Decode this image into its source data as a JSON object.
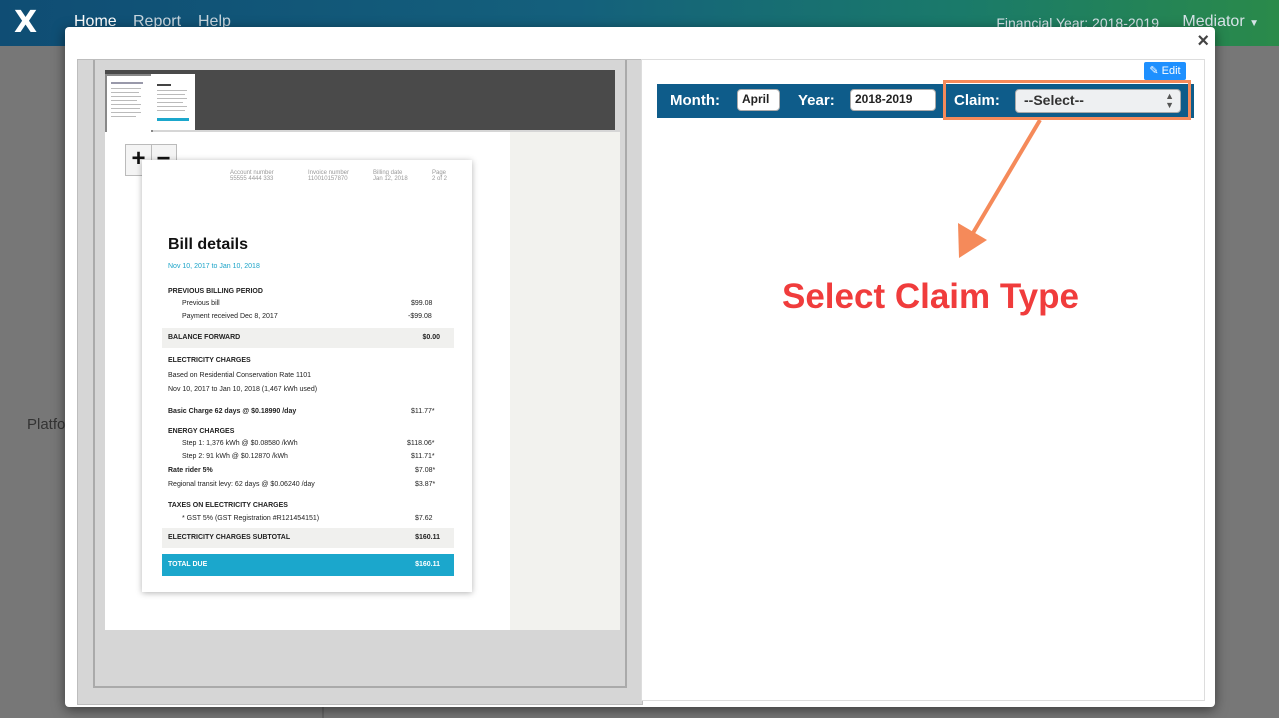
{
  "navbar": {
    "logo": "X",
    "items": [
      "Home",
      "Report",
      "Help"
    ],
    "financial_year": "Financial Year: 2018-2019",
    "user_menu": "Mediator"
  },
  "background": {
    "partial_text": "Platfo"
  },
  "modal": {
    "close_label": "×"
  },
  "viewer": {
    "zoom_in": "+",
    "zoom_out": "−",
    "document": {
      "header": [
        {
          "label": "Account number",
          "value": "55555 4444 333"
        },
        {
          "label": "Invoice number",
          "value": "110010157870"
        },
        {
          "label": "Billing date",
          "value": "Jan 12, 2018"
        },
        {
          "label": "Page",
          "value": "2 of 2"
        }
      ],
      "title": "Bill details",
      "period": "Nov 10, 2017 to Jan 10, 2018",
      "previous_heading": "PREVIOUS BILLING PERIOD",
      "previous_bill": "Previous bill",
      "previous_bill_amt": "$99.08",
      "payment_received": "Payment received Dec 8, 2017",
      "payment_received_amt": "-$99.08",
      "balance_forward": "BALANCE FORWARD",
      "balance_forward_amt": "$0.00",
      "electricity_heading": "ELECTRICITY CHARGES",
      "rate_line": "Based on Residential Conservation Rate 1101",
      "usage_line": "Nov 10, 2017 to Jan 10, 2018 (1,467 kWh used)",
      "basic_charge": "Basic Charge 62 days @ $0.18990 /day",
      "basic_charge_amt": "$11.77*",
      "energy_heading": "ENERGY CHARGES",
      "step1": "Step 1: 1,376 kWh @ $0.08580 /kWh",
      "step1_amt": "$118.06*",
      "step2": "Step 2: 91 kWh @ $0.12870 /kWh",
      "step2_amt": "$11.71*",
      "rate_rider": "Rate rider 5%",
      "rate_rider_amt": "$7.08*",
      "transit": "Regional transit levy: 62 days @ $0.06240 /day",
      "transit_amt": "$3.87*",
      "taxes_heading": "TAXES ON ELECTRICITY CHARGES",
      "gst": "* GST 5% (GST Registration #R121454151)",
      "gst_amt": "$7.62",
      "subtotal": "ELECTRICITY CHARGES SUBTOTAL",
      "subtotal_amt": "$160.11",
      "total_due": "TOTAL DUE",
      "total_due_amt": "$160.11"
    }
  },
  "form": {
    "edit_label": "✎ Edit",
    "month_label": "Month:",
    "month_value": "April",
    "year_label": "Year:",
    "year_value": "2018-2019",
    "claim_label": "Claim:",
    "claim_selected": "--Select--"
  },
  "annotation": {
    "text": "Select Claim Type",
    "color": "#f03c3c",
    "arrow_color": "#f58a5a"
  }
}
